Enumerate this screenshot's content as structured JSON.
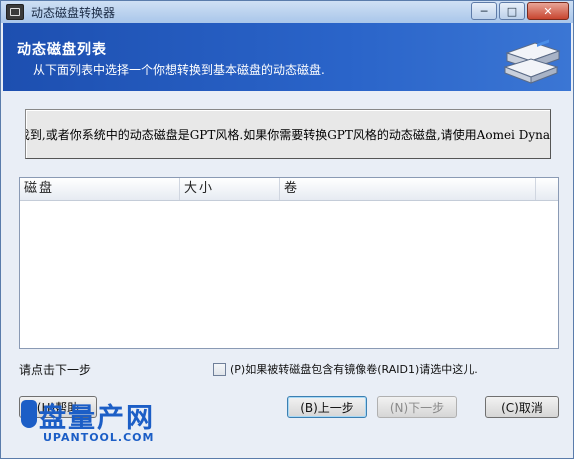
{
  "window": {
    "title": "动态磁盘转换器",
    "controls": {
      "minimize": "─",
      "maximize": "□",
      "close": "✕"
    }
  },
  "header": {
    "title": "动态磁盘列表",
    "subtitle": "从下面列表中选择一个你想转换到基本磁盘的动态磁盘."
  },
  "message": "找到,或者你系统中的动态磁盘是GPT风格.如果你需要转换GPT风格的动态磁盘,请使用Aomei Dyna",
  "table": {
    "columns": [
      "磁盘",
      "大小",
      "卷"
    ],
    "rows": []
  },
  "hint": "请点击下一步",
  "checkbox": {
    "label": "(P)如果被转磁盘包含有镜像卷(RAID1)请选中这儿.",
    "checked": false
  },
  "buttons": {
    "help": "(H)帮助",
    "back": "(B)上一步",
    "next": "(N)下一步",
    "cancel": "(C)取消"
  },
  "watermark": {
    "main": "盘量产网",
    "sub": "UPANTOOL.COM"
  },
  "colors": {
    "header_bg": "#2a64c9",
    "accent": "#1c5ec6"
  }
}
